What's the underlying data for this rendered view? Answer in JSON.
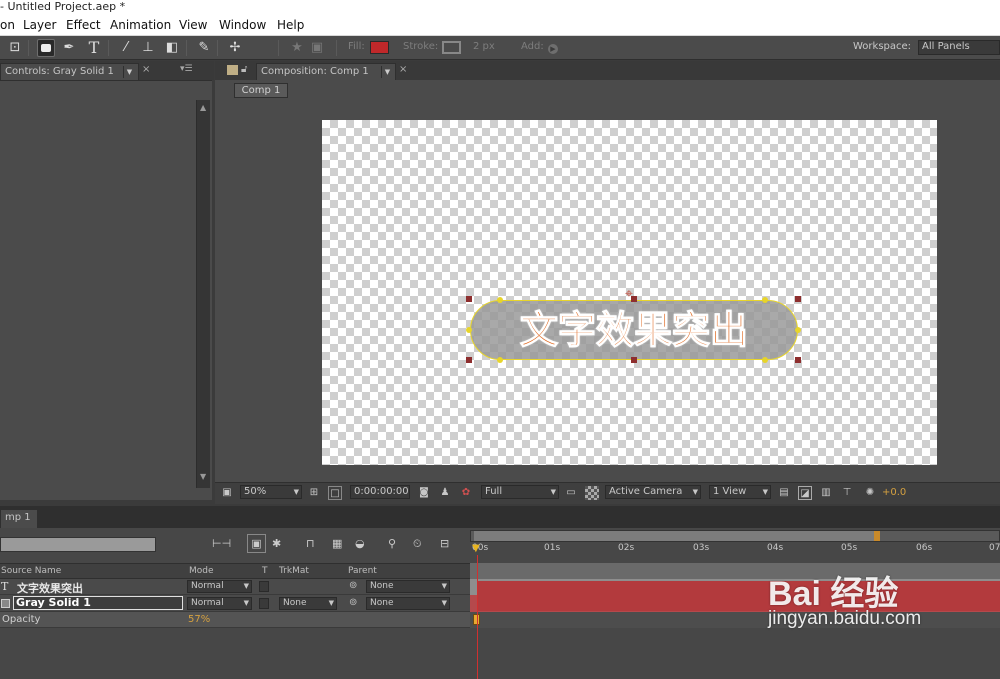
{
  "window": {
    "title": "- Untitled Project.aep *"
  },
  "menu": [
    "on",
    "Layer",
    "Effect",
    "Animation",
    "View",
    "Window",
    "Help"
  ],
  "toolbar": {
    "fill_label": "Fill:",
    "stroke_label": "Stroke:",
    "stroke_width": "2 px",
    "add_label": "Add:",
    "fill_color": "#c0282a",
    "workspace_label": "Workspace:",
    "workspace_value": "All Panels"
  },
  "controls_panel": {
    "tab": "Controls: Gray Solid 1"
  },
  "comp_panel": {
    "tab": "Composition: Comp 1",
    "subtab": "Comp 1",
    "text": "文字效果突出",
    "text_color": "#e0651a",
    "viewer": {
      "zoom": "50%",
      "timecode": "0:00:00:00",
      "resolution": "Full",
      "camera": "Active Camera",
      "views": "1 View",
      "exposure": "+0.0"
    }
  },
  "timeline": {
    "tab": "mp 1",
    "ruler": [
      "00s",
      "01s",
      "02s",
      "03s",
      "04s",
      "05s",
      "06s",
      "07"
    ],
    "headers": {
      "source": "Source Name",
      "mode": "Mode",
      "t": "T",
      "trkmat": "TrkMat",
      "parent": "Parent"
    },
    "layers": [
      {
        "type_icon": "T",
        "name": "文字效果突出",
        "mode": "Normal",
        "trkmat": "",
        "parent": "None"
      },
      {
        "type_icon": "",
        "name": "Gray Solid 1",
        "mode": "Normal",
        "trkmat": "None",
        "parent": "None"
      }
    ],
    "property": {
      "name": "Opacity",
      "value": "57%"
    }
  },
  "watermark": {
    "brand": "Bai  经验",
    "url": "jingyan.baidu.com"
  }
}
